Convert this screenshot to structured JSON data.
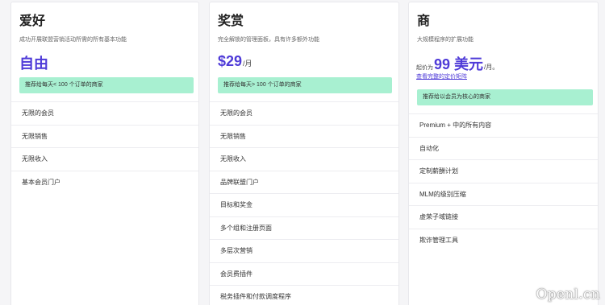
{
  "plans": [
    {
      "name": "爱好",
      "description": "成功开展联盟营销活动所需的所有基本功能",
      "price": "自由",
      "recommendation": "推荐给每天< 100 个订单的商家",
      "features": [
        "无限的会员",
        "无限销售",
        "无限收入",
        "基本会员门户"
      ]
    },
    {
      "name": "奖赏",
      "description": "完全解锁的管理面板，具有许多额外功能",
      "price": "$29",
      "price_period": "/月",
      "recommendation": "推荐给每天> 100 个订单的商家",
      "features": [
        "无限的会员",
        "无限销售",
        "无限收入",
        "品牌联盟门户",
        "目标和奖金",
        "多个组和注册页面",
        "多层次营销",
        "会员费插件",
        "税务插件和付款调度程序"
      ]
    },
    {
      "name": "商",
      "description": "大规模程序的扩展功能",
      "price_prefix": "起价为",
      "price": "99 美元",
      "price_period": "/月。",
      "pricing_link": "查看完整的定价矩阵",
      "recommendation": "推荐给以会员为核心的商家",
      "features": [
        "Premium + 中的所有内容",
        "自动化",
        "定制薪酬计划",
        "MLM的级别压缩",
        "虚荣子域链接",
        "欺诈管理工具"
      ]
    }
  ],
  "watermark": "Openl.cn"
}
